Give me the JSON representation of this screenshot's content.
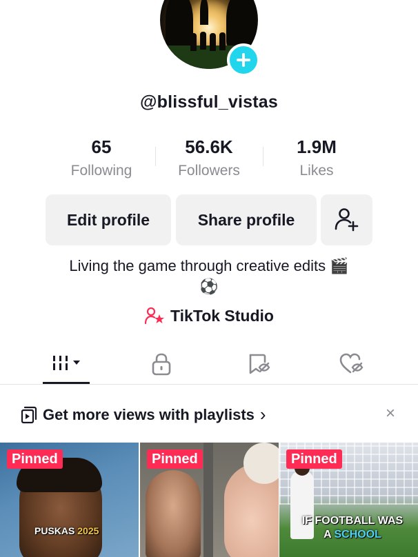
{
  "profile": {
    "username": "@blissful_vistas",
    "bio_line1": "Living the game through creative edits 🎬",
    "bio_line2": "⚽"
  },
  "stats": [
    {
      "value": "65",
      "label": "Following"
    },
    {
      "value": "56.6K",
      "label": "Followers"
    },
    {
      "value": "1.9M",
      "label": "Likes"
    }
  ],
  "buttons": {
    "edit_profile": "Edit profile",
    "share_profile": "Share profile"
  },
  "studio": {
    "label": "TikTok Studio"
  },
  "banner": {
    "text": "Get more views with playlists",
    "chevron": "›",
    "close": "×"
  },
  "videos": [
    {
      "badge": "Pinned",
      "caption": "PUSKAS",
      "caption_year": "2025"
    },
    {
      "badge": "Pinned"
    },
    {
      "badge": "Pinned",
      "caption_line1": "IF FOOTBALL WAS",
      "caption_line2_a": "A",
      "caption_line2_b": "SCHOOL"
    }
  ],
  "colors": {
    "accent": "#fe2c55",
    "add_button": "#20d5ec",
    "text_secondary": "#8a8b91"
  },
  "icons": [
    "plus-icon",
    "add-friend-icon",
    "studio-person-star-icon",
    "grid-icon",
    "lock-icon",
    "repost-icon",
    "liked-icon",
    "playlist-icon",
    "close-icon"
  ]
}
